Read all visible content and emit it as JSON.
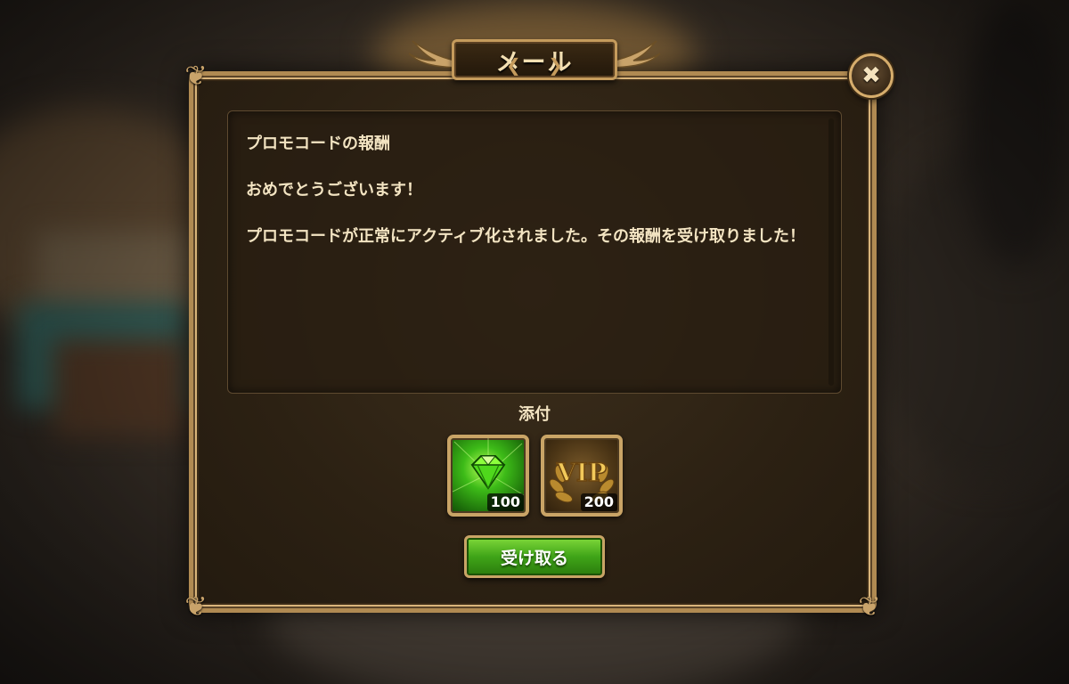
{
  "window": {
    "title": "メール"
  },
  "mail": {
    "subject": "プロモコードの報酬",
    "greeting": "おめでとうございます！",
    "body": "プロモコードが正常にアクティブ化されました。その報酬を受け取りました！"
  },
  "attachments": {
    "label": "添付",
    "items": [
      {
        "icon": "green-gem-icon",
        "count": "100"
      },
      {
        "icon": "vip-icon",
        "count": "200"
      }
    ]
  },
  "actions": {
    "claim_label": "受け取る",
    "close_icon": "close-icon"
  },
  "colors": {
    "panel_border": "#b08a52",
    "text": "#f3e4c2",
    "claim_button": "#3fa418",
    "gem": "#3dbb18",
    "vip_gold": "#e0b34a"
  }
}
